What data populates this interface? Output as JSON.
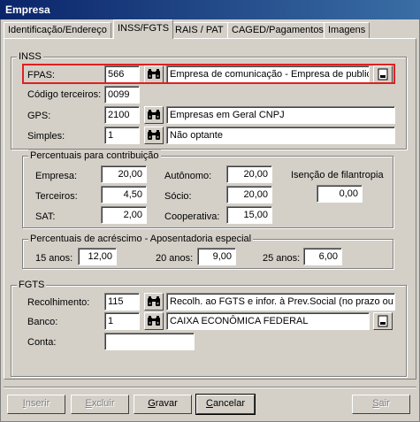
{
  "window": {
    "title": "Empresa"
  },
  "tabs": [
    {
      "label": "Identificação/Endereço"
    },
    {
      "label": "INSS/FGTS"
    },
    {
      "label": "RAIS / PAT"
    },
    {
      "label": "CAGED/Pagamentos"
    },
    {
      "label": "Imagens"
    }
  ],
  "inss": {
    "group_label": "INSS",
    "fpas": {
      "label": "FPAS:",
      "code": "566",
      "description": "Empresa de comunicação - Empresa de publicida"
    },
    "codigo_terceiros": {
      "label": "Código terceiros:",
      "value": "0099"
    },
    "gps": {
      "label": "GPS:",
      "code": "2100",
      "description": "Empresas em Geral CNPJ"
    },
    "simples": {
      "label": "Simples:",
      "code": "1",
      "description": "Não optante"
    }
  },
  "percentuais": {
    "group_label": "Percentuais para contribuição",
    "empresa": {
      "label": "Empresa:",
      "value": "20,00"
    },
    "terceiros": {
      "label": "Terceiros:",
      "value": "4,50"
    },
    "sat": {
      "label": "SAT:",
      "value": "2,00"
    },
    "autonomo": {
      "label": "Autônomo:",
      "value": "20,00"
    },
    "socio": {
      "label": "Sócio:",
      "value": "20,00"
    },
    "cooperativa": {
      "label": "Cooperativa:",
      "value": "15,00"
    },
    "isencao": {
      "label": "Isenção de filantropia",
      "value": "0,00"
    }
  },
  "acrescimo": {
    "group_label": "Percentuais de acréscimo - Aposentadoria especial",
    "anos15": {
      "label": "15 anos:",
      "value": "12,00"
    },
    "anos20": {
      "label": "20 anos:",
      "value": "9,00"
    },
    "anos25": {
      "label": "25 anos:",
      "value": "6,00"
    }
  },
  "fgts": {
    "group_label": "FGTS",
    "recolhimento": {
      "label": "Recolhimento:",
      "code": "115",
      "description": "Recolh. ao FGTS e infor. à Prev.Social (no prazo ou e"
    },
    "banco": {
      "label": "Banco:",
      "code": "1",
      "description": "CAIXA ECONÔMICA FEDERAL"
    },
    "conta": {
      "label": "Conta:",
      "value": ""
    }
  },
  "buttons": {
    "inserir": {
      "first": "I",
      "rest": "nserir"
    },
    "excluir": {
      "first": "E",
      "rest": "xcluir"
    },
    "gravar": {
      "first": "G",
      "rest": "ravar"
    },
    "cancelar": {
      "first": "C",
      "rest": "ancelar"
    },
    "sair": {
      "first": "S",
      "rest": "air"
    }
  },
  "icons": {
    "search": "binoculars-icon",
    "detail": "document-icon"
  },
  "colors": {
    "titlebar": "#0a246a",
    "highlight": "#e02020",
    "disabled_text": "#808080"
  }
}
